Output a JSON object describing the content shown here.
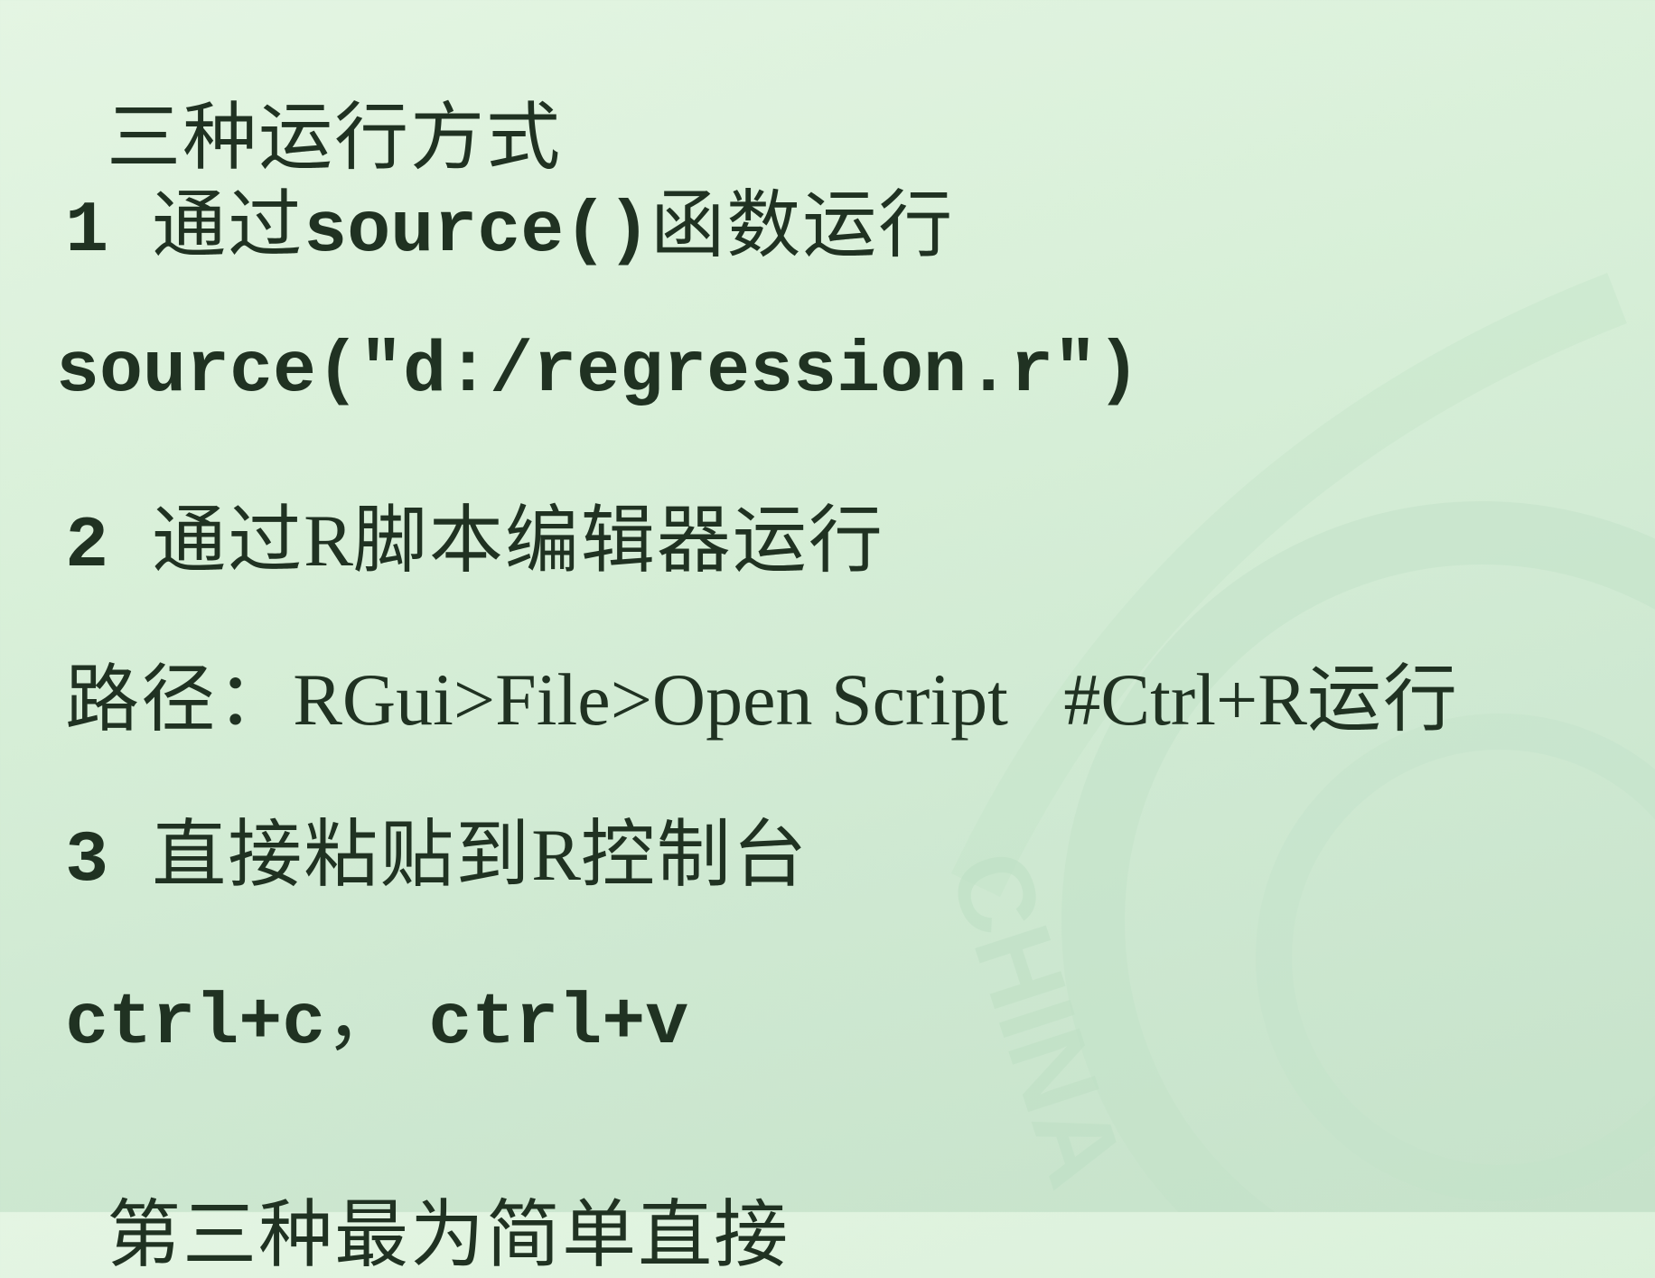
{
  "lines": {
    "title": "三种运行方式",
    "item1": {
      "number": "1",
      "pre": "通过",
      "code": "source()",
      "post": "函数运行"
    },
    "code1": "source(\"d:/regression.r\")",
    "item2": {
      "number": "2",
      "pre": "通过",
      "r": "R",
      "post": "脚本编辑器运行"
    },
    "path": {
      "label": "路径：",
      "value": "RGui>File>Open Script   #Ctrl+R",
      "suffix": "运行"
    },
    "item3": {
      "number": "3",
      "pre": "直接粘贴到",
      "r": "R",
      "post": "控制台"
    },
    "keys": {
      "copy": "ctrl+c",
      "sep": "，",
      "paste": "ctrl+v"
    },
    "conclusion": "第三种最为简单直接"
  },
  "watermark": {
    "text": "CHINA",
    "color": "#b9dcc0"
  }
}
